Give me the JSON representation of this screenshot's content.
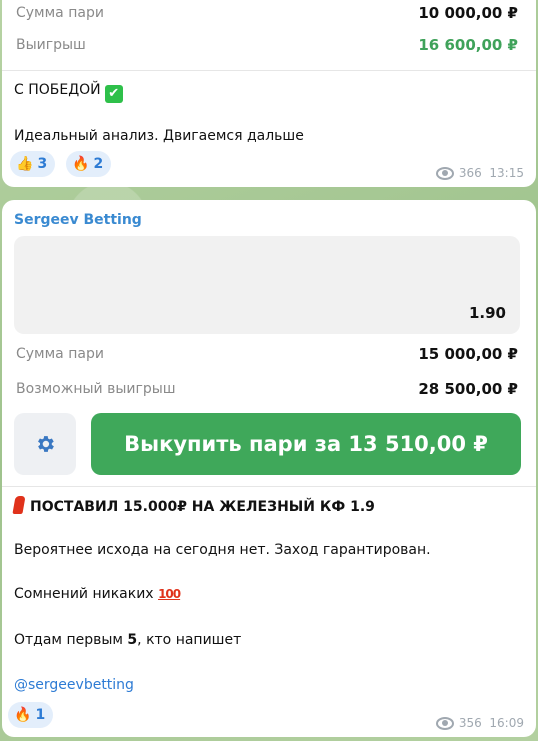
{
  "msg1": {
    "bet_label": "Сумма пари",
    "bet_value": "10 000,00 ₽",
    "win_label": "Выигрыш",
    "win_value": "16 600,00 ₽",
    "line1": "С ПОБЕДОЙ",
    "line1_emoji": "✔",
    "line2": "Идеальный анализ. Двигаемся дальше",
    "reactions": [
      {
        "emoji": "👍",
        "count": "3"
      },
      {
        "emoji": "🔥",
        "count": "2"
      }
    ],
    "views": "366",
    "time": "13:15"
  },
  "msg2": {
    "author": "Sergeev Betting",
    "odds": "1.90",
    "bet_label": "Сумма пари",
    "bet_value": "15 000,00 ₽",
    "possible_win_label": "Возможный выигрыш",
    "possible_win_value": "28 500,00 ₽",
    "buy_button": "Выкупить пари за 13 510,00 ₽",
    "gear_icon": "gear-icon",
    "headline": "ПОСТАВИЛ 15.000₽ НА ЖЕЛЕЗНЫЙ КФ 1.9",
    "line1": "Вероятнее исхода на сегодня нет. Заход гарантирован.",
    "line2": "Сомнений никаких",
    "line2_emoji": "100",
    "line3_prefix": "Отдам первым ",
    "line3_bold": "5",
    "line3_suffix": ", кто напишет",
    "handle": "@sergeevbetting",
    "reaction": {
      "emoji": "🔥",
      "count": "1"
    },
    "views": "356",
    "time": "16:09"
  },
  "colors": {
    "accent_green": "#3fa85a",
    "link_blue": "#2d7bd4",
    "author_blue": "#3a8ad1"
  }
}
